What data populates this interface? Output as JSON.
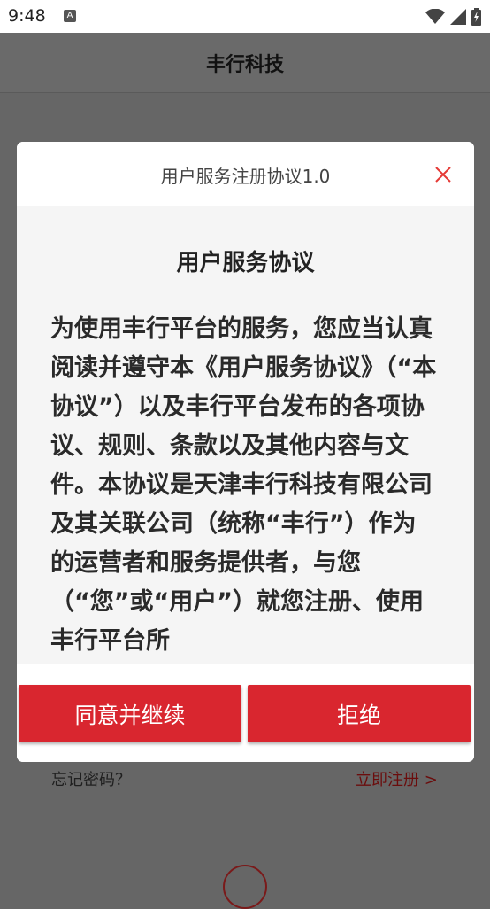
{
  "status_bar": {
    "time": "9:48",
    "notification_glyph": "A"
  },
  "header": {
    "title": "丰行科技"
  },
  "background": {
    "forgot_password": "忘记密码？",
    "register": "立即注册 >"
  },
  "dialog": {
    "title": "用户服务注册协议1.0",
    "close_icon": "close-x",
    "heading": "用户服务协议",
    "text": "为使用丰行平台的服务，您应当认真阅读并遵守本《用户服务协议》（“本协议”）以及丰行平台发布的各项协议、规则、条款以及其他内容与文件。本协议是天津丰行科技有限公司及其关联公司（统称“丰行”）作为的运营者和服务提供者，与您（“您”或“用户”）就您注册、使用丰行平台所",
    "agree_button": "同意并继续",
    "reject_button": "拒绝"
  },
  "colors": {
    "accent": "#d9262f",
    "overlay": "#666666",
    "close_icon": "#e53935"
  }
}
